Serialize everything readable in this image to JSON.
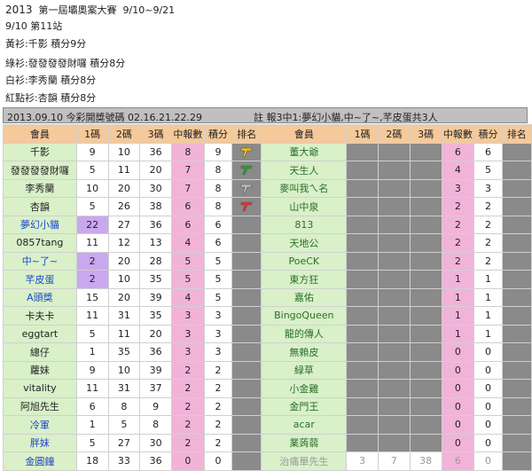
{
  "header": {
    "year": "2013",
    "title": "第一屆壩奧案大賽",
    "range": "9/10~9/21",
    "station": "9/10 第11站",
    "lines": [
      "黃衫:千影  積分9分",
      "綠衫:發發發發財囉  積分8分",
      "白衫:李秀蘭  積分8分",
      "紅點衫:杏韻  積分8分"
    ]
  },
  "infobar": {
    "date_label": "2013.09.10  今彩開獎號碼  02.16.21.22.29",
    "note": "註  報3中1:夢幻小貓,中~了~,芊皮蛋共3人"
  },
  "columns": {
    "left": [
      "會員",
      "1碼",
      "2碼",
      "3碼",
      "中報數",
      "積分",
      "排名"
    ],
    "right": [
      "會員",
      "1碼",
      "2碼",
      "3碼",
      "中報數",
      "積分",
      "排名"
    ]
  },
  "left_rows": [
    {
      "name": "千影",
      "c1": "9",
      "c2": "10",
      "c3": "36",
      "hits": "8",
      "pts": "9",
      "rank": "yellow"
    },
    {
      "name": "發發發發財囉",
      "c1": "5",
      "c2": "11",
      "c3": "20",
      "hits": "7",
      "pts": "8",
      "rank": "green"
    },
    {
      "name": "李秀蘭",
      "c1": "10",
      "c2": "20",
      "c3": "30",
      "hits": "7",
      "pts": "8",
      "rank": "white"
    },
    {
      "name": "杏韻",
      "c1": "5",
      "c2": "26",
      "c3": "38",
      "hits": "6",
      "pts": "8",
      "rank": "red"
    },
    {
      "name": "夢幻小貓",
      "c1": "22",
      "c2": "27",
      "c3": "36",
      "hits": "6",
      "pts": "6",
      "rank": ""
    },
    {
      "name": "0857tang",
      "c1": "11",
      "c2": "12",
      "c3": "13",
      "hits": "4",
      "pts": "6",
      "rank": ""
    },
    {
      "name": "中~了~",
      "c1": "2",
      "c2": "20",
      "c3": "28",
      "hits": "5",
      "pts": "5",
      "rank": ""
    },
    {
      "name": "芊皮蛋",
      "c1": "2",
      "c2": "10",
      "c3": "35",
      "hits": "5",
      "pts": "5",
      "rank": ""
    },
    {
      "name": "A頭獎",
      "c1": "15",
      "c2": "20",
      "c3": "39",
      "hits": "4",
      "pts": "5",
      "rank": ""
    },
    {
      "name": "卡夫卡",
      "c1": "11",
      "c2": "31",
      "c3": "35",
      "hits": "3",
      "pts": "3",
      "rank": ""
    },
    {
      "name": "eggtart",
      "c1": "5",
      "c2": "11",
      "c3": "20",
      "hits": "3",
      "pts": "3",
      "rank": ""
    },
    {
      "name": "總仔",
      "c1": "1",
      "c2": "35",
      "c3": "36",
      "hits": "3",
      "pts": "3",
      "rank": ""
    },
    {
      "name": "蘿妹",
      "c1": "9",
      "c2": "10",
      "c3": "39",
      "hits": "2",
      "pts": "2",
      "rank": ""
    },
    {
      "name": "vitality",
      "c1": "11",
      "c2": "31",
      "c3": "37",
      "hits": "2",
      "pts": "2",
      "rank": ""
    },
    {
      "name": "阿旭先生",
      "c1": "6",
      "c2": "8",
      "c3": "9",
      "hits": "2",
      "pts": "2",
      "rank": ""
    },
    {
      "name": "冷軍",
      "c1": "1",
      "c2": "5",
      "c3": "8",
      "hits": "2",
      "pts": "2",
      "rank": ""
    },
    {
      "name": "胖妹",
      "c1": "5",
      "c2": "27",
      "c3": "30",
      "hits": "2",
      "pts": "2",
      "rank": ""
    },
    {
      "name": "金圓鐘",
      "c1": "18",
      "c2": "33",
      "c3": "36",
      "hits": "0",
      "pts": "0",
      "rank": ""
    }
  ],
  "right_rows": [
    {
      "name": "董大爺",
      "hits": "6",
      "pts": "6"
    },
    {
      "name": "天生人",
      "hits": "4",
      "pts": "5"
    },
    {
      "name": "麥叫我ㄟ名",
      "hits": "3",
      "pts": "3"
    },
    {
      "name": "山中泉",
      "hits": "2",
      "pts": "2"
    },
    {
      "name": "813",
      "hits": "2",
      "pts": "2"
    },
    {
      "name": "天地公",
      "hits": "2",
      "pts": "2"
    },
    {
      "name": "PoeCK",
      "hits": "2",
      "pts": "2"
    },
    {
      "name": "東方狂",
      "hits": "1",
      "pts": "1"
    },
    {
      "name": "嘉佑",
      "hits": "1",
      "pts": "1"
    },
    {
      "name": "BingoQueen",
      "hits": "1",
      "pts": "1"
    },
    {
      "name": "龍的傳人",
      "hits": "1",
      "pts": "1"
    },
    {
      "name": "無賴皮",
      "hits": "0",
      "pts": "0"
    },
    {
      "name": "緑草",
      "hits": "0",
      "pts": "0"
    },
    {
      "name": "小金雞",
      "hits": "0",
      "pts": "0"
    },
    {
      "name": "金門王",
      "hits": "0",
      "pts": "0"
    },
    {
      "name": "acar",
      "hits": "0",
      "pts": "0"
    },
    {
      "name": "業蒟蒻",
      "hits": "0",
      "pts": "0"
    },
    {
      "name": "治痛單先生",
      "c1": "3",
      "c2": "7",
      "c3": "38",
      "hits": "6",
      "pts": "0"
    }
  ],
  "colors": {
    "yellow": "#f3c21a",
    "green": "#2e9b2e",
    "white": "#bdbdbd",
    "red": "#e53030"
  }
}
